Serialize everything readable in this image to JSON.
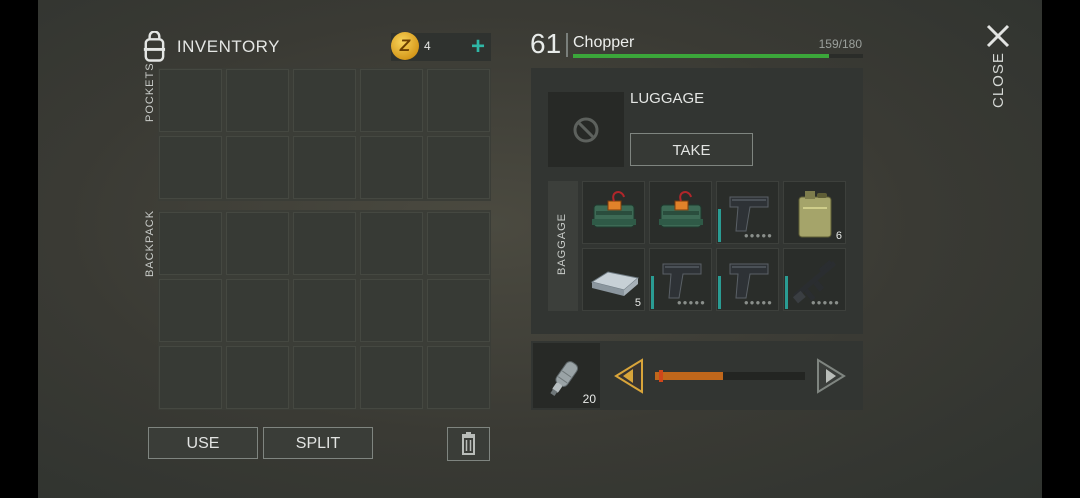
{
  "inventory": {
    "title": "INVENTORY",
    "coins": "4",
    "pockets_label": "POCKETS",
    "backpack_label": "BACKPACK"
  },
  "actions": {
    "use_label": "USE",
    "split_label": "SPLIT"
  },
  "player": {
    "level": "61",
    "name": "Chopper",
    "health_text": "159/180",
    "health_fraction": 0.883
  },
  "container": {
    "title": "LUGGAGE",
    "take_label": "TAKE",
    "section_label": "BAGGAGE",
    "items": [
      {
        "icon": "explosive-charge-icon",
        "qty": ""
      },
      {
        "icon": "explosive-charge-icon",
        "qty": ""
      },
      {
        "icon": "pistol-icon",
        "qty": ""
      },
      {
        "icon": "jerrycan-icon",
        "qty": "6"
      },
      {
        "icon": "metal-ingot-icon",
        "qty": "5"
      },
      {
        "icon": "pistol-icon",
        "qty": ""
      },
      {
        "icon": "pistol-icon",
        "qty": ""
      },
      {
        "icon": "assault-rifle-icon",
        "qty": ""
      }
    ]
  },
  "transfer": {
    "item_icon": "water-bottle-icon",
    "item_qty": "20",
    "slider_fraction": 0.45
  },
  "close_label": "CLOSE",
  "colors": {
    "accent_teal": "#2fb7a6",
    "health_green": "#3ba63a",
    "slider_orange": "#c0671b",
    "arrow_gold": "#d9a53a"
  }
}
